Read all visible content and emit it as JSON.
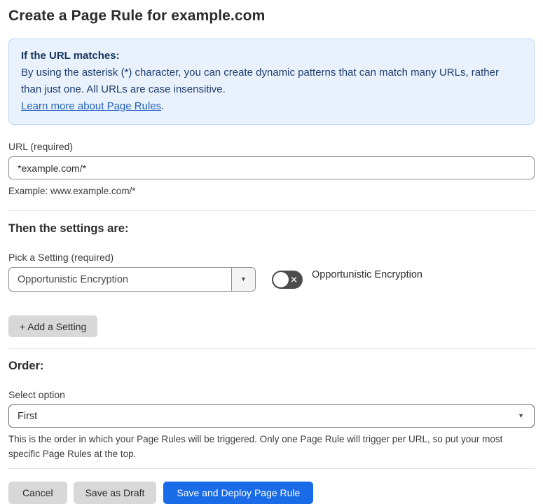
{
  "header": {
    "title": "Create a Page Rule for example.com"
  },
  "info_box": {
    "heading": "If the URL matches:",
    "body": "By using the asterisk (*) character, you can create dynamic patterns that can match many URLs, rather than just one. All URLs are case insensitive.",
    "link": "Learn more about Page Rules",
    "link_suffix": "."
  },
  "url_field": {
    "label": "URL (required)",
    "value": "*example.com/*",
    "helper": "Example: www.example.com/*"
  },
  "settings": {
    "heading": "Then the settings are:",
    "pick_label": "Pick a Setting (required)",
    "selected_setting": "Opportunistic Encryption",
    "toggle_label": "Opportunistic Encryption",
    "toggle_state": "off",
    "add_button_label": "+ Add a Setting"
  },
  "order": {
    "heading": "Order:",
    "label": "Select option",
    "selected_option": "First",
    "helper": "This is the order in which your Page Rules will be triggered. Only one Page Rule will trigger per URL, so put your most specific Page Rules at the top."
  },
  "footer": {
    "cancel_label": "Cancel",
    "save_draft_label": "Save as Draft",
    "save_deploy_label": "Save and Deploy Page Rule"
  },
  "icons": {
    "caret_down": "▼",
    "toggle_off_x": "✕"
  },
  "colors": {
    "primary_blue": "#1a6be8",
    "info_bg": "#e9f2fc",
    "info_border": "#bcd6f4",
    "info_text": "#1d3c6e",
    "link_blue": "#2361c0",
    "toggle_off_bg": "#4d4d4d",
    "neutral_button_bg": "#d8d8d8"
  }
}
